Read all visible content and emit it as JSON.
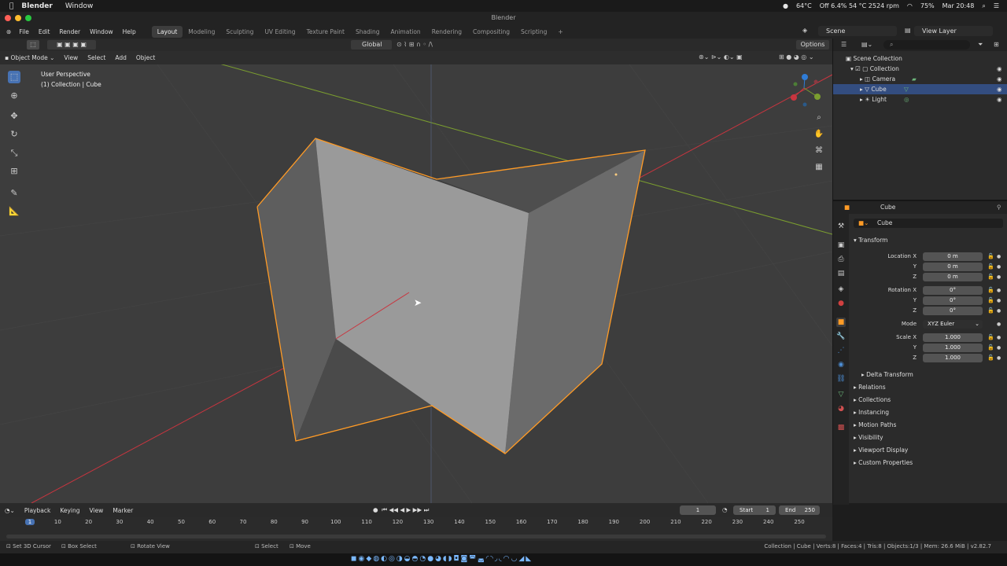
{
  "mac_menu": {
    "app": "Blender",
    "window": "Window"
  },
  "mac_status": {
    "temp": "64°C",
    "stats": "Off 6.4% 54 °C 2524 rpm",
    "battery": "75%",
    "clock": "Mar 20:48"
  },
  "window_title": "Blender",
  "top_menu": [
    "File",
    "Edit",
    "Render",
    "Window",
    "Help"
  ],
  "workspaces": [
    "Layout",
    "Modeling",
    "Sculpting",
    "UV Editing",
    "Texture Paint",
    "Shading",
    "Animation",
    "Rendering",
    "Compositing",
    "Scripting"
  ],
  "active_workspace": "Layout",
  "scene_name": "Scene",
  "view_layer": "View Layer",
  "tool_header": {
    "orientation": "Global",
    "options": "Options"
  },
  "viewport_header": {
    "mode": "Object Mode",
    "menus": [
      "View",
      "Select",
      "Add",
      "Object"
    ]
  },
  "viewport_info": {
    "line1": "User Perspective",
    "line2": "(1) Collection | Cube"
  },
  "gizmo": {
    "x": "X",
    "y": "Y",
    "z": "Z"
  },
  "outliner": {
    "root": "Scene Collection",
    "items": [
      {
        "name": "Collection",
        "indent": 1
      },
      {
        "name": "Camera",
        "indent": 2
      },
      {
        "name": "Cube",
        "indent": 2,
        "selected": true
      },
      {
        "name": "Light",
        "indent": 2
      }
    ]
  },
  "properties": {
    "header": "Cube",
    "object_name": "Cube",
    "panel_title": "Transform",
    "location": {
      "label": "Location X",
      "x": "0 m",
      "y": "0 m",
      "z": "0 m"
    },
    "rotation": {
      "label": "Rotation X",
      "x": "0°",
      "y": "0°",
      "z": "0°"
    },
    "mode_label": "Mode",
    "mode_value": "XYZ Euler",
    "scale": {
      "label": "Scale X",
      "x": "1.000",
      "y": "1.000",
      "z": "1.000"
    },
    "axis_y": "Y",
    "axis_z": "Z",
    "delta": "Delta Transform",
    "sections": [
      "Relations",
      "Collections",
      "Instancing",
      "Motion Paths",
      "Visibility",
      "Viewport Display",
      "Custom Properties"
    ]
  },
  "timeline": {
    "menus": [
      "Playback",
      "Keying",
      "View",
      "Marker"
    ],
    "current_frame": "1",
    "start_label": "Start",
    "start": "1",
    "end_label": "End",
    "end": "250",
    "ticks": [
      "1",
      "10",
      "20",
      "30",
      "40",
      "50",
      "60",
      "70",
      "80",
      "90",
      "100",
      "110",
      "120",
      "130",
      "140",
      "150",
      "160",
      "170",
      "180",
      "190",
      "200",
      "210",
      "220",
      "230",
      "240",
      "250"
    ]
  },
  "statusbar": {
    "left": [
      "Set 3D Cursor",
      "Box Select",
      "Rotate View"
    ],
    "mid": [
      "Select",
      "Move"
    ],
    "right": "Collection | Cube | Verts:8 | Faces:4 | Tris:8 | Objects:1/3 | Mem: 26.6 MiB | v2.82.7"
  },
  "colors": {
    "accent": "#4772b3",
    "selection": "#ff9b26",
    "x_axis": "#c9353f",
    "y_axis": "#7b9e2f",
    "z_axis": "#2f7cd6"
  }
}
